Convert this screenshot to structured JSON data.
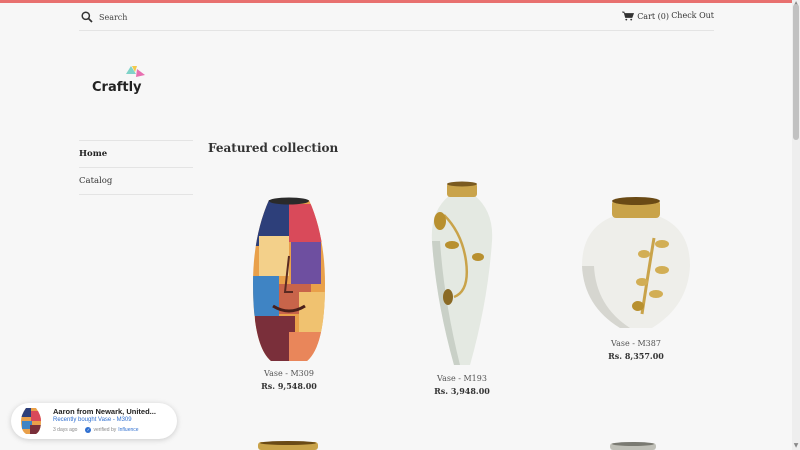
{
  "header": {
    "search_placeholder": "Search",
    "cart_label": "Cart (0)",
    "checkout_label": "Check Out"
  },
  "logo": {
    "text": "Craftly"
  },
  "sidebar": {
    "items": [
      {
        "label": "Home",
        "active": true
      },
      {
        "label": "Catalog",
        "active": false
      }
    ]
  },
  "main": {
    "section_title": "Featured collection",
    "products": [
      {
        "title": "Vase - M309",
        "price": "Rs. 9,548.00"
      },
      {
        "title": "Vase - M193",
        "price": "Rs. 3,948.00"
      },
      {
        "title": "Vase - M387",
        "price": "Rs. 8,357.00"
      }
    ]
  },
  "notification": {
    "title": "Aaron from Newark, United...",
    "subtitle": "Recently bought Vase - M309",
    "time": "3 days ago",
    "verified_label": "verified by",
    "brand": "Influence"
  },
  "colors": {
    "accent_bar": "#e8706f",
    "background": "#f7f7f7",
    "link_blue": "#2f6fd0",
    "gold": "#c9a34a"
  },
  "icons": [
    "search-icon",
    "cart-icon",
    "check-icon"
  ]
}
